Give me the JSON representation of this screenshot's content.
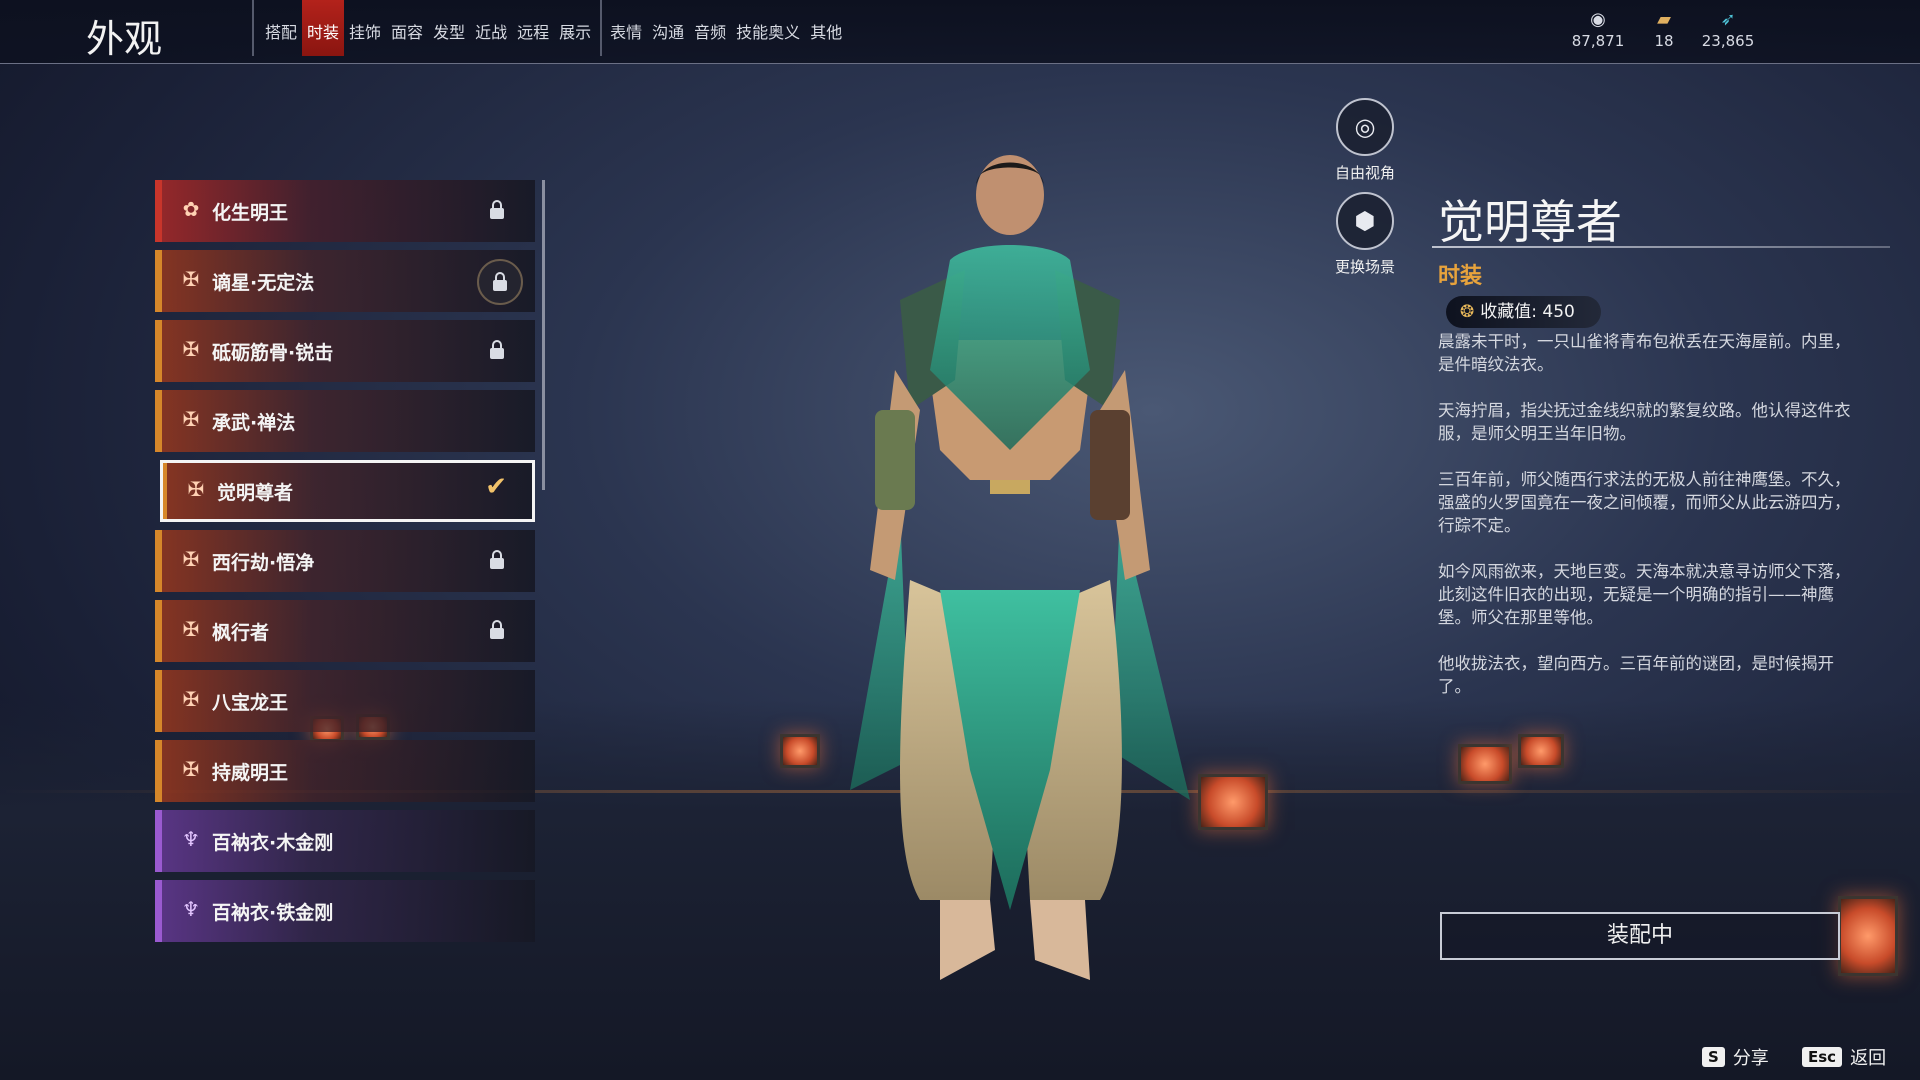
{
  "header": {
    "title": "外观",
    "tabs": [
      {
        "label": "搭配"
      },
      {
        "label": "时装",
        "active": true
      },
      {
        "label": "挂饰"
      },
      {
        "label": "面容"
      },
      {
        "label": "发型"
      },
      {
        "label": "近战"
      },
      {
        "label": "远程"
      },
      {
        "label": "展示"
      },
      {
        "label": "表情"
      },
      {
        "label": "沟通"
      },
      {
        "label": "音频"
      },
      {
        "label": "技能奥义"
      },
      {
        "label": "其他"
      }
    ],
    "currencies": [
      {
        "icon": "coin-stack-icon",
        "value": "87,871"
      },
      {
        "icon": "ticket-icon",
        "value": "18"
      },
      {
        "icon": "feather-icon",
        "value": "23,865"
      }
    ]
  },
  "outfits": [
    {
      "name": "化生明王",
      "rarity": "red",
      "locked": true
    },
    {
      "name": "谪星·无定法",
      "rarity": "orange",
      "locked": true,
      "ring": true
    },
    {
      "name": "砥砺筋骨·锐击",
      "rarity": "orange",
      "locked": true
    },
    {
      "name": "承武·禅法",
      "rarity": "orange",
      "locked": false
    },
    {
      "name": "觉明尊者",
      "rarity": "orange",
      "locked": false,
      "selected": true
    },
    {
      "name": "西行劫·悟净",
      "rarity": "orange",
      "locked": true
    },
    {
      "name": "枫行者",
      "rarity": "orange",
      "locked": true
    },
    {
      "name": "八宝龙王",
      "rarity": "orange",
      "locked": false
    },
    {
      "name": "持威明王",
      "rarity": "orange",
      "locked": false
    },
    {
      "name": "百衲衣·木金刚",
      "rarity": "purple",
      "locked": false
    },
    {
      "name": "百衲衣·铁金刚",
      "rarity": "purple",
      "locked": false
    }
  ],
  "view_buttons": {
    "free_camera": "自由视角",
    "change_scene": "更换场景"
  },
  "detail": {
    "name": "觉明尊者",
    "type": "时装",
    "collect_label": "收藏值: 450",
    "paragraphs": [
      "晨露未干时，一只山雀将青布包袱丢在天海屋前。内里，是件暗纹法衣。",
      "天海拧眉，指尖抚过金线织就的繁复纹路。他认得这件衣服，是师父明王当年旧物。",
      "三百年前，师父随西行求法的无极人前往神鹰堡。不久，强盛的火罗国竟在一夜之间倾覆，而师父从此云游四方，行踪不定。",
      "如今风雨欲来，天地巨变。天海本就决意寻访师父下落，此刻这件旧衣的出现，无疑是一个明确的指引——神鹰堡。师父在那里等他。",
      "他收拢法衣，望向西方。三百年前的谜团，是时候揭开了。"
    ],
    "equip_button": "装配中"
  },
  "footer": {
    "share_key": "S",
    "share_label": "分享",
    "back_key": "Esc",
    "back_label": "返回"
  }
}
